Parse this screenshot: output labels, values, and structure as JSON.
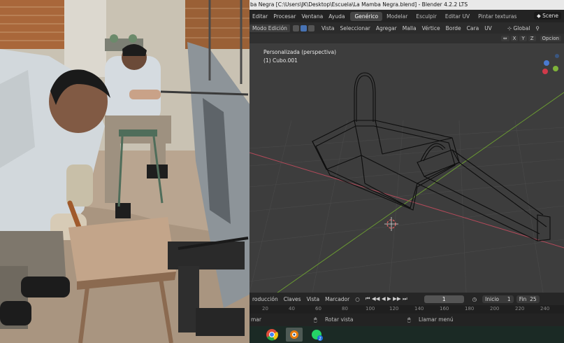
{
  "window": {
    "title": "ba Negra [C:\\Users\\JK\\Desktop\\Escuela\\La Mamba Negra.blend] - Blender 4.2.2 LTS"
  },
  "topbar": {
    "menus": [
      "Editar",
      "Procesar",
      "Ventana",
      "Ayuda"
    ],
    "workspaces": [
      "Genérico",
      "Modelar",
      "Esculpir",
      "Editar UV",
      "Pintar texturas"
    ],
    "active_workspace": "Genérico",
    "scene": "Scene"
  },
  "viewport_header": {
    "mode": "Modo Edición",
    "menus": [
      "Vista",
      "Seleccionar",
      "Agregar",
      "Malla",
      "Vértice",
      "Borde",
      "Cara",
      "UV"
    ],
    "orientation": "Global",
    "options": "Opcion",
    "axes": [
      "X",
      "Y",
      "Z"
    ]
  },
  "viewport": {
    "view_name": "Personalizada (perspectiva)",
    "object_name": "(1) Cubo.001"
  },
  "timeline": {
    "menus": [
      "roducción",
      "Claves",
      "Vista",
      "Marcador"
    ],
    "current_frame": "1",
    "start_label": "Inicio",
    "start_value": "1",
    "end_label": "Fin",
    "end_value": "25",
    "ruler": [
      "20",
      "40",
      "60",
      "80",
      "100",
      "120",
      "140",
      "160",
      "180",
      "200",
      "220",
      "240"
    ]
  },
  "statusbar": {
    "left": "mar",
    "rotate": "Rotar vista",
    "menu": "Llamar menú"
  },
  "taskbar": {
    "badge": "2"
  },
  "colors": {
    "accent": "#4772b3",
    "x_axis": "#b34a5a",
    "y_axis": "#6a9a32",
    "viewport_bg": "#3d3d3d"
  }
}
